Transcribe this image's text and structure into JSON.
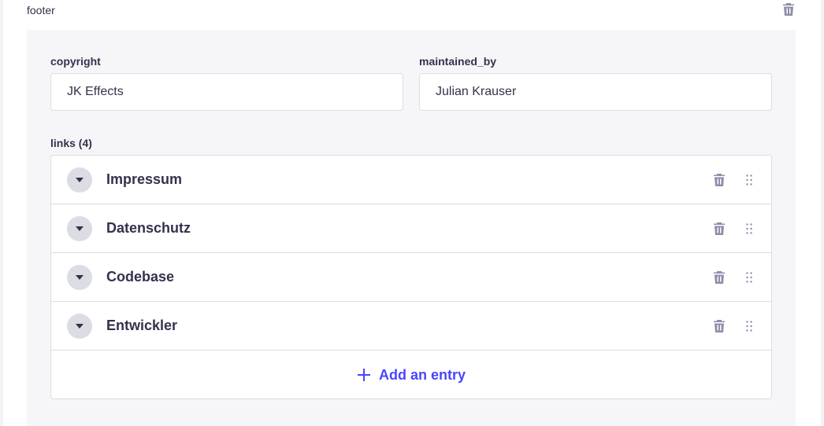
{
  "component": {
    "title": "footer",
    "delete_icon": "trash-icon"
  },
  "fields": {
    "copyright": {
      "label": "copyright",
      "value": "JK Effects"
    },
    "maintained_by": {
      "label": "maintained_by",
      "value": "Julian Krauser"
    }
  },
  "links": {
    "label": "links (4)",
    "items": [
      {
        "label": "Impressum"
      },
      {
        "label": "Datenschutz"
      },
      {
        "label": "Codebase"
      },
      {
        "label": "Entwickler"
      }
    ],
    "add_label": "Add an entry"
  },
  "colors": {
    "accent": "#4945ff",
    "icon_muted": "#8e8ea9",
    "text": "#32324d",
    "panel_bg": "#f6f6f9",
    "border": "#dcdce4"
  }
}
